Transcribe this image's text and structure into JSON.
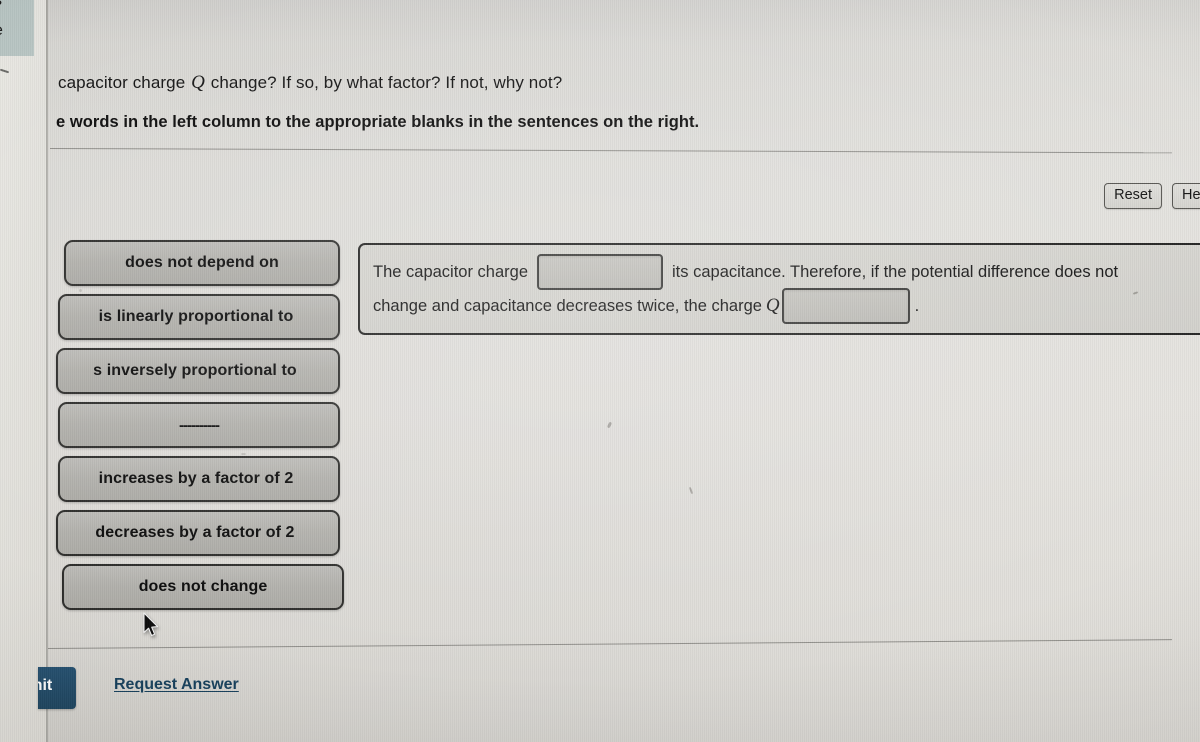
{
  "corner_panel": {
    "line1": "s",
    "line2": "e"
  },
  "prompt": {
    "question": "capacitor charge Q change? If so, by what factor? If not, why not?",
    "question_prefix": "capacitor charge",
    "question_symbol": "Q",
    "question_suffix": "change? If so, by what factor? If not, why not?",
    "instruction": "e words in the left column to the appropriate blanks in the sentences on the right."
  },
  "toolbar": {
    "reset_label": "Reset",
    "help_label": "Help"
  },
  "word_bank": {
    "items": [
      {
        "label": "does not depend on"
      },
      {
        "label": "is linearly proportional to"
      },
      {
        "label": "s inversely proportional to"
      },
      {
        "label": "----------"
      },
      {
        "label": "increases by a factor of 2"
      },
      {
        "label": "decreases by a factor of 2"
      },
      {
        "label": "does not change"
      }
    ]
  },
  "sentence": {
    "line1_before": "The capacitor charge",
    "blank1_value": "",
    "line1_after": "its capacitance. Therefore, if the potential difference does not",
    "line2_before": "change and capacitance decreases twice, the charge",
    "line2_symbol": "Q",
    "blank2_value": "",
    "line2_after": "."
  },
  "footer": {
    "submit_label": "Submit",
    "request_answer_label": "Request Answer"
  },
  "colors": {
    "submit_background": "#1e455f",
    "link": "#17405c",
    "chip_background": "#b2b1ac",
    "chip_border": "#2d2d2b",
    "panel_background": "#d2d1cc",
    "corner_panel": "#b9c6c4"
  }
}
